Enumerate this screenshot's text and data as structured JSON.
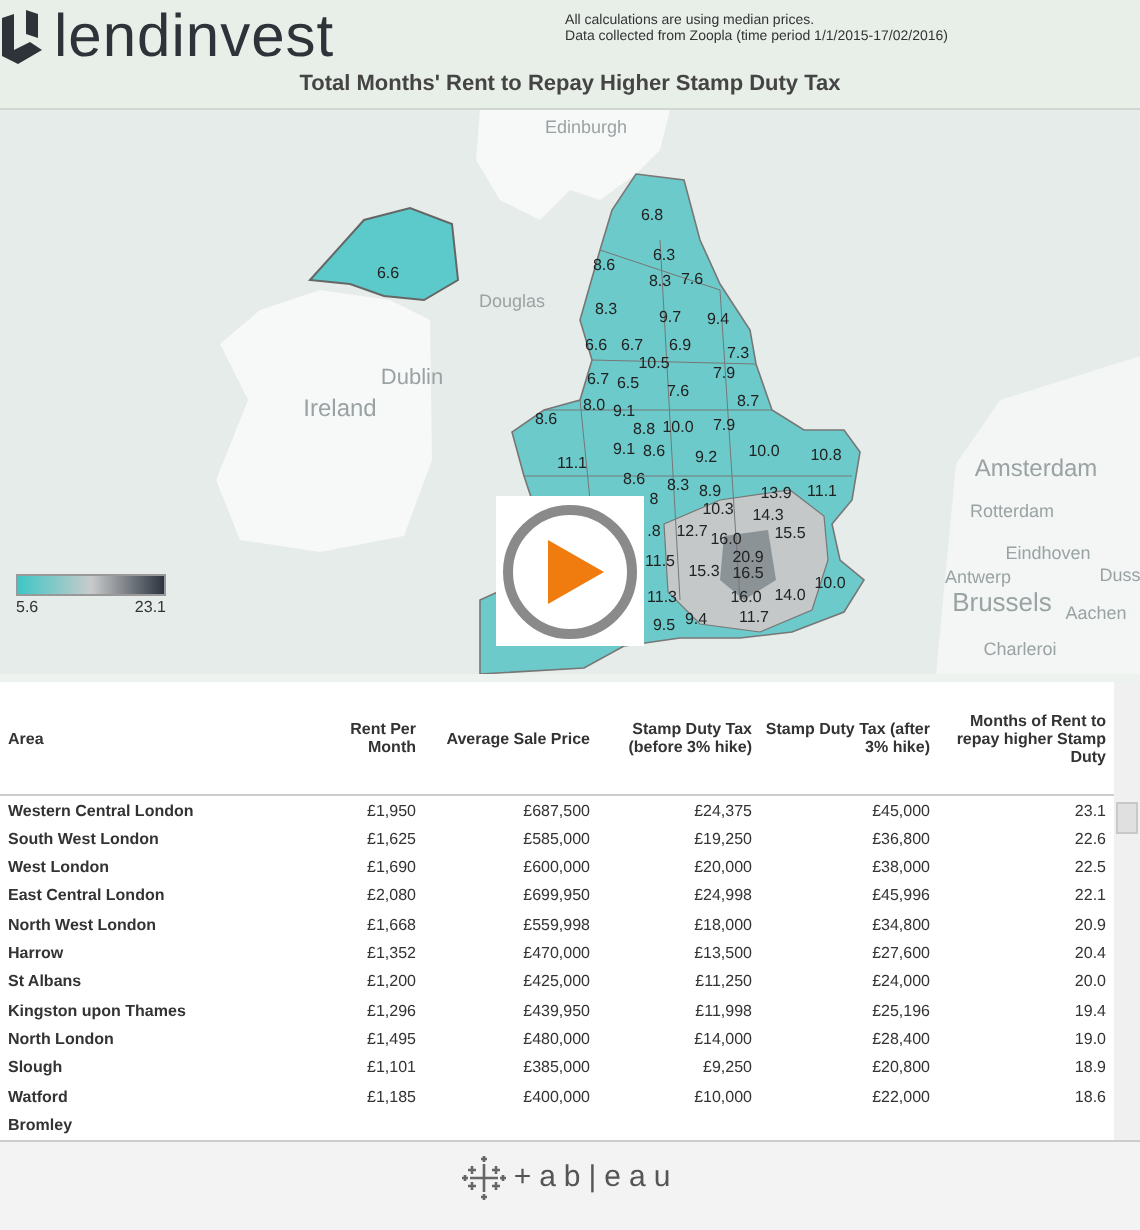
{
  "header": {
    "brand": "lendinvest",
    "notes": [
      "All calculations are using median prices.",
      "Data collected from Zoopla (time period 1/1/2015-17/02/2016)"
    ],
    "title": "Total Months' Rent to Repay Higher Stamp Duty Tax"
  },
  "map": {
    "place_labels": [
      "Edinburgh",
      "Douglas",
      "Dublin",
      "Ireland",
      "Amsterdam",
      "Rotterdam",
      "Eindhoven",
      "Antwerp",
      "Duss",
      "Brussels",
      "Aachen",
      "Charleroi"
    ],
    "region_values": [
      "6.6",
      "6.8",
      "6.3",
      "8.6",
      "8.3",
      "7.6",
      "8.3",
      "9.7",
      "9.4",
      "6.6",
      "6.7",
      "6.9",
      "7.3",
      "10.5",
      "6.7",
      "6.5",
      "7.9",
      "7.6",
      "8.0",
      "9.1",
      "8.7",
      "8.6",
      "8.8",
      "10.0",
      "7.9",
      "9.1",
      "8.6",
      "9.2",
      "10.0",
      "10.8",
      "11.1",
      "8.6",
      "8.3",
      "8.9",
      "13.9",
      "11.1",
      "8",
      "10.3",
      "14.3",
      ".8",
      "12.7",
      "16.0",
      "15.5",
      "20.9",
      "15.3",
      "11.5",
      "16.5",
      "10.0",
      "11.3",
      "16.0",
      "14.0",
      "9.4",
      "11.7",
      "9.5"
    ],
    "legend": {
      "min": "5.6",
      "max": "23.1"
    }
  },
  "table": {
    "columns": [
      "Area",
      "Rent Per Month",
      "Average Sale Price",
      "Stamp Duty Tax (before 3% hike)",
      "Stamp Duty Tax (after 3% hike)",
      "Months of Rent to repay higher Stamp Duty"
    ],
    "rows": [
      [
        "Western Central London",
        "£1,950",
        "£687,500",
        "£24,375",
        "£45,000",
        "23.1"
      ],
      [
        "South West London",
        "£1,625",
        "£585,000",
        "£19,250",
        "£36,800",
        "22.6"
      ],
      [
        "West London",
        "£1,690",
        "£600,000",
        "£20,000",
        "£38,000",
        "22.5"
      ],
      [
        "East Central London",
        "£2,080",
        "£699,950",
        "£24,998",
        "£45,996",
        "22.1"
      ],
      [
        "North West London",
        "£1,668",
        "£559,998",
        "£18,000",
        "£34,800",
        "20.9"
      ],
      [
        "Harrow",
        "£1,352",
        "£470,000",
        "£13,500",
        "£27,600",
        "20.4"
      ],
      [
        "St Albans",
        "£1,200",
        "£425,000",
        "£11,250",
        "£24,000",
        "20.0"
      ],
      [
        "Kingston upon Thames",
        "£1,296",
        "£439,950",
        "£11,998",
        "£25,196",
        "19.4"
      ],
      [
        "North London",
        "£1,495",
        "£480,000",
        "£14,000",
        "£28,400",
        "19.0"
      ],
      [
        "Slough",
        "£1,101",
        "£385,000",
        "£9,250",
        "£20,800",
        "18.9"
      ],
      [
        "Watford",
        "£1,185",
        "£400,000",
        "£10,000",
        "£22,000",
        "18.6"
      ],
      [
        "Bromley"
      ]
    ]
  },
  "footer": {
    "logo_text": "+ab|eau"
  }
}
